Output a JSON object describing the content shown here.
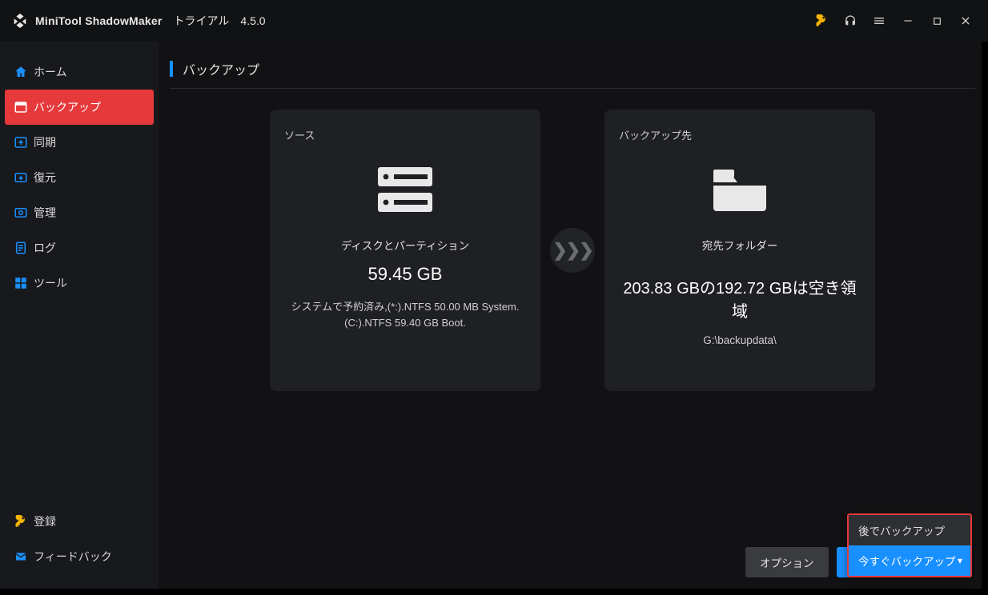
{
  "app": {
    "title": "MiniTool ShadowMaker",
    "trial": "トライアル",
    "version": "4.5.0"
  },
  "sidebar": {
    "items": [
      {
        "label": "ホーム"
      },
      {
        "label": "バックアップ"
      },
      {
        "label": "同期"
      },
      {
        "label": "復元"
      },
      {
        "label": "管理"
      },
      {
        "label": "ログ"
      },
      {
        "label": "ツール"
      }
    ],
    "bottom": [
      {
        "label": "登録"
      },
      {
        "label": "フィードバック"
      }
    ]
  },
  "page": {
    "title": "バックアップ"
  },
  "source": {
    "label": "ソース",
    "subtitle": "ディスクとパーティション",
    "size": "59.45 GB",
    "detail": "システムで予約済み,(*:).NTFS 50.00 MB System.(C:).NTFS 59.40 GB Boot."
  },
  "dest": {
    "label": "バックアップ先",
    "subtitle": "宛先フォルダー",
    "space": "203.83 GBの192.72 GBは空き領域",
    "path": "G:\\backupdata\\"
  },
  "footer": {
    "options": "オプション",
    "backup_now": "今すぐバックアップ"
  },
  "dropdown": {
    "later": "後でバックアップ",
    "now": "今すぐバックアップ"
  }
}
